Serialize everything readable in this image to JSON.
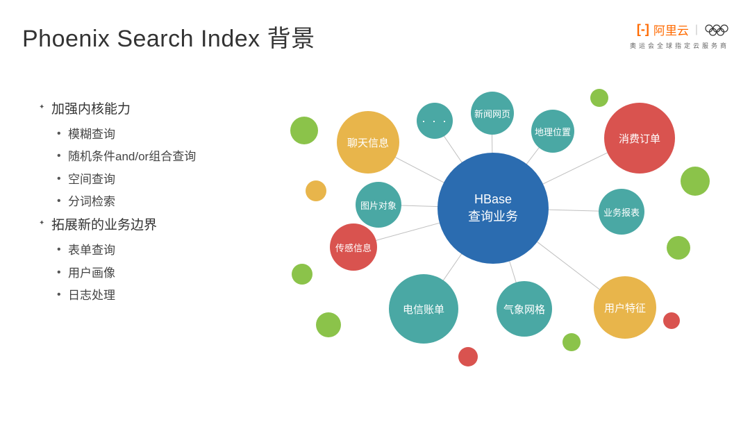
{
  "title": "Phoenix Search Index 背景",
  "logo": {
    "brand": "阿里云",
    "tagline": "奥运会全球指定云服务商"
  },
  "bullets": {
    "g1": {
      "title": "加强内核能力",
      "items": [
        "模糊查询",
        "随机条件and/or组合查询",
        "空间查询",
        "分词检索"
      ]
    },
    "g2": {
      "title": "拓展新的业务边界",
      "items": [
        "表单查询",
        "用户画像",
        "日志处理"
      ]
    }
  },
  "diagram": {
    "center": "HBase\n查询业务",
    "nodes": {
      "chat": "聊天信息",
      "dots": "· · ·",
      "news": "新闻网页",
      "geo": "地理位置",
      "order": "消费订单",
      "image": "图片对象",
      "report": "业务报表",
      "sensor": "传感信息",
      "telecom": "电信账单",
      "weather": "气象网格",
      "user": "用户特征"
    }
  },
  "colors": {
    "blue": "#2b6cb0",
    "teal": "#4aa8a4",
    "red": "#d9534f",
    "green": "#8bc34a",
    "yellow": "#e8b54b"
  }
}
